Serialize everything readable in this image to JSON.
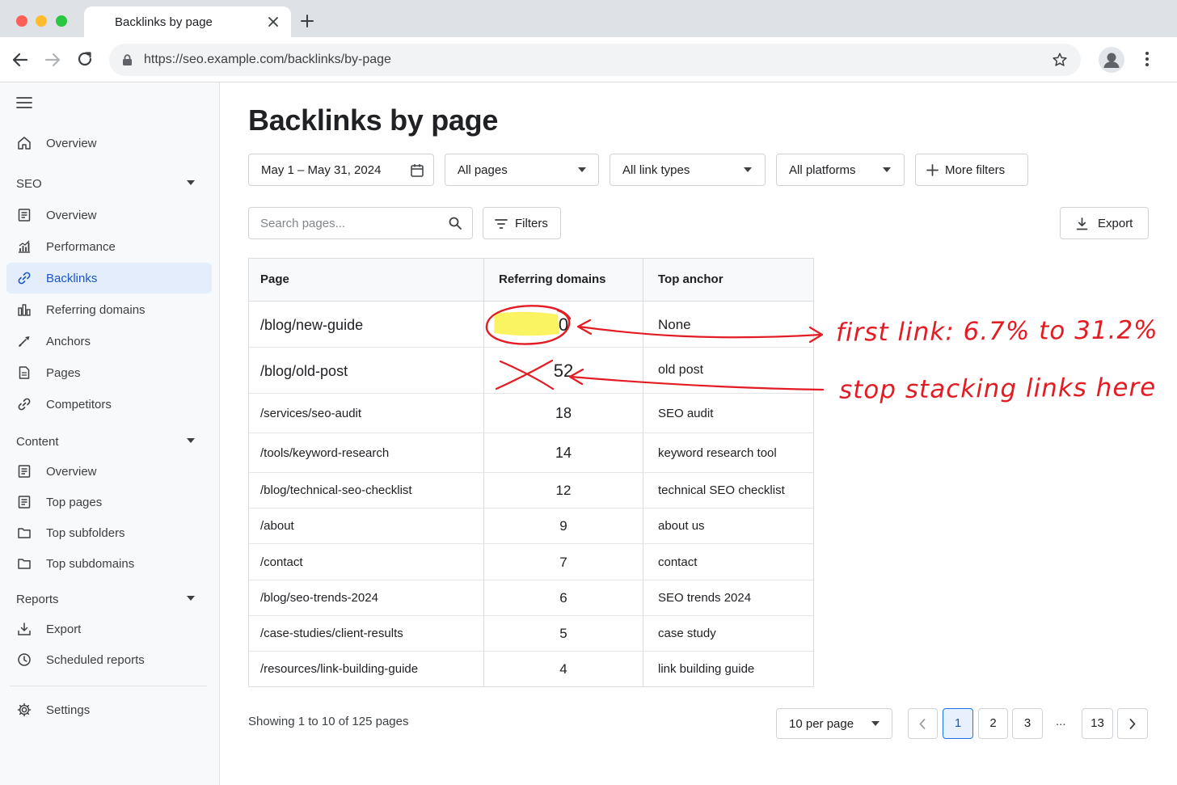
{
  "browser": {
    "tab_title": "Backlinks by page",
    "url": "https://seo.example.com/backlinks/by-page",
    "colors": {
      "close": "#ff5f57",
      "minimize": "#febc2e",
      "maximize": "#28c840"
    }
  },
  "sidebar": {
    "top_item": {
      "label": "Overview",
      "icon": "home-icon"
    },
    "sections": [
      {
        "title": "SEO",
        "items": [
          {
            "label": "Overview",
            "icon": "document-icon"
          },
          {
            "label": "Performance",
            "icon": "bar-chart-icon"
          },
          {
            "label": "Backlinks",
            "icon": "link-icon",
            "active": true
          },
          {
            "label": "Referring domains",
            "icon": "columns-chart-icon"
          },
          {
            "label": "Anchors",
            "icon": "anchor-icon"
          },
          {
            "label": "Pages",
            "icon": "page-icon"
          },
          {
            "label": "Competitors",
            "icon": "link-icon"
          }
        ]
      },
      {
        "title": "Content",
        "items": [
          {
            "label": "Overview",
            "icon": "document-icon"
          },
          {
            "label": "Top pages",
            "icon": "document-icon"
          },
          {
            "label": "Top subfolders",
            "icon": "folder-icon"
          },
          {
            "label": "Top subdomains",
            "icon": "folder-icon"
          }
        ]
      },
      {
        "title": "Reports",
        "items": [
          {
            "label": "Export",
            "icon": "export-icon"
          },
          {
            "label": "Scheduled reports",
            "icon": "clock-icon"
          }
        ]
      }
    ],
    "settings": {
      "label": "Settings",
      "icon": "gear-icon"
    }
  },
  "main": {
    "title": "Backlinks by page",
    "filters": {
      "date_range": "May 1 – May 31, 2024",
      "pages": "All pages",
      "link_types": "All link types",
      "platforms": "All platforms",
      "more_filters": "More filters"
    },
    "search_placeholder": "Search pages...",
    "filters_button": "Filters",
    "export_button": "Export",
    "table": {
      "columns": [
        "Page",
        "Referring domains",
        "Top anchor"
      ],
      "rows": [
        {
          "page": "/blog/new-guide",
          "referring_domains": "0",
          "top_anchor": "None"
        },
        {
          "page": "/blog/old-post",
          "referring_domains": "52",
          "top_anchor": "old post"
        },
        {
          "page": "/services/seo-audit",
          "referring_domains": "18",
          "top_anchor": "SEO audit"
        },
        {
          "page": "/tools/keyword-research",
          "referring_domains": "14",
          "top_anchor": "keyword research tool"
        },
        {
          "page": "/blog/technical-seo-checklist",
          "referring_domains": "12",
          "top_anchor": "technical SEO checklist"
        },
        {
          "page": "/about",
          "referring_domains": "9",
          "top_anchor": "about us"
        },
        {
          "page": "/contact",
          "referring_domains": "7",
          "top_anchor": "contact"
        },
        {
          "page": "/blog/seo-trends-2024",
          "referring_domains": "6",
          "top_anchor": "SEO trends 2024"
        },
        {
          "page": "/case-studies/client-results",
          "referring_domains": "5",
          "top_anchor": "case study"
        },
        {
          "page": "/resources/link-building-guide",
          "referring_domains": "4",
          "top_anchor": "link building guide"
        }
      ]
    },
    "pagination": {
      "showing": "Showing 1 to 10 of 125 pages",
      "per_page": "10 per page",
      "pages": [
        "1",
        "2",
        "3"
      ],
      "ellipsis": "...",
      "last_page": "13",
      "current": "1"
    }
  },
  "annotations": {
    "note_1": "first link: 6.7% to 31.2%",
    "note_2": "stop stacking links here",
    "ink_color": "#e31b23",
    "highlight_color": "#fbf35a"
  }
}
